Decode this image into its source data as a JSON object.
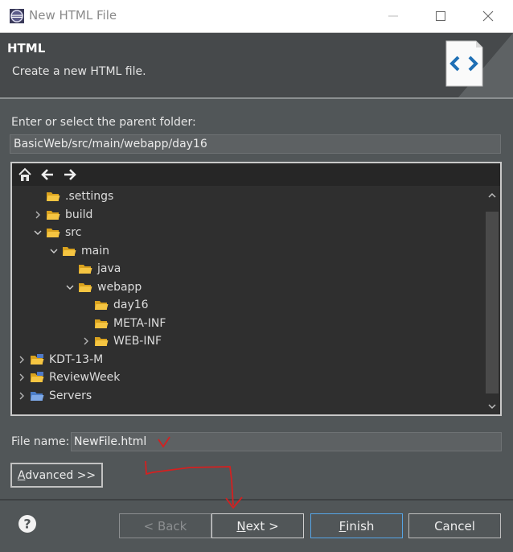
{
  "window": {
    "title": "New HTML File",
    "controls": [
      "minimize-icon",
      "maximize-icon",
      "close-icon"
    ]
  },
  "header": {
    "title": "HTML",
    "description": "Create a new HTML file.",
    "image_icon": "html-file-wizard-icon"
  },
  "parent_folder": {
    "label": "Enter or select the parent folder:",
    "value": "BasicWeb/src/main/webapp/day16"
  },
  "tree": {
    "toolbar": [
      "home-icon",
      "back-arrow-icon",
      "forward-arrow-icon"
    ],
    "items": [
      {
        "label": ".settings",
        "depth": 1,
        "expander": "none",
        "icon": "folder-icon"
      },
      {
        "label": "build",
        "depth": 1,
        "expander": "collapsed",
        "icon": "folder-icon"
      },
      {
        "label": "src",
        "depth": 1,
        "expander": "expanded",
        "icon": "folder-icon"
      },
      {
        "label": "main",
        "depth": 2,
        "expander": "expanded",
        "icon": "folder-icon"
      },
      {
        "label": "java",
        "depth": 3,
        "expander": "none",
        "icon": "folder-icon"
      },
      {
        "label": "webapp",
        "depth": 3,
        "expander": "expanded",
        "icon": "folder-icon"
      },
      {
        "label": "day16",
        "depth": 4,
        "expander": "none",
        "icon": "folder-icon"
      },
      {
        "label": "META-INF",
        "depth": 4,
        "expander": "none",
        "icon": "folder-icon"
      },
      {
        "label": "WEB-INF",
        "depth": 4,
        "expander": "collapsed",
        "icon": "folder-icon"
      },
      {
        "label": "KDT-13-M",
        "depth": 0,
        "expander": "collapsed",
        "icon": "project-icon"
      },
      {
        "label": "ReviewWeek",
        "depth": 0,
        "expander": "collapsed",
        "icon": "project-icon"
      },
      {
        "label": "Servers",
        "depth": 0,
        "expander": "collapsed",
        "icon": "folder-icon"
      }
    ]
  },
  "file_name": {
    "label": "File name:",
    "value": "NewFile.html"
  },
  "advanced": {
    "label_mnemonic": "A",
    "label_rest": "dvanced >>"
  },
  "buttons": {
    "help_icon": "help-icon",
    "back": "< Back",
    "next_mnemonic": "N",
    "next_rest": "ext >",
    "finish_mnemonic": "F",
    "finish_rest": "inish",
    "cancel": "Cancel"
  },
  "colors": {
    "dialog_bg": "#515658",
    "header_bg": "#46494b",
    "tree_bg": "#2f2f2f",
    "focus_border": "#56a5e6",
    "annotation_red": "#d42020"
  }
}
